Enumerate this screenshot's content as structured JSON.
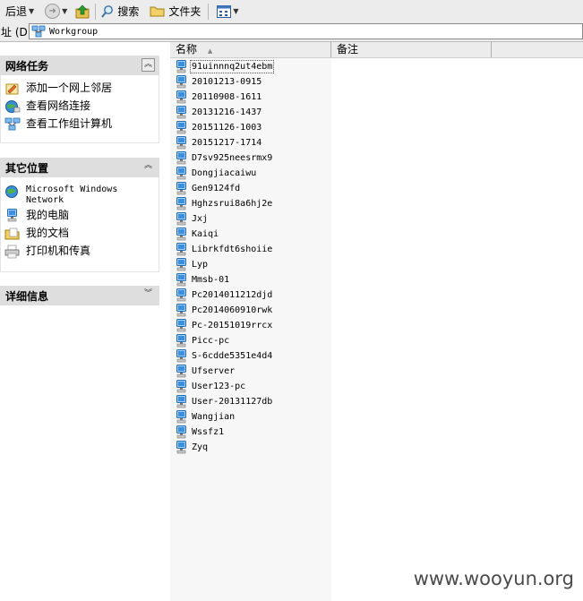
{
  "toolbar": {
    "back_label": "后退",
    "search_label": "搜索",
    "folders_label": "文件夹"
  },
  "address": {
    "label": "址 (D)",
    "value": "Workgroup"
  },
  "task_pane": {
    "network_tasks": {
      "title": "网络任务",
      "items": [
        {
          "label": "添加一个网上邻居",
          "icon": "add-network-place-icon"
        },
        {
          "label": "查看网络连接",
          "icon": "network-connections-icon"
        },
        {
          "label": "查看工作组计算机",
          "icon": "workgroup-computers-icon"
        }
      ]
    },
    "other_places": {
      "title": "其它位置",
      "items": [
        {
          "label": "Microsoft Windows Network",
          "icon": "windows-network-icon"
        },
        {
          "label": "我的电脑",
          "icon": "my-computer-icon"
        },
        {
          "label": "我的文档",
          "icon": "my-documents-icon"
        },
        {
          "label": "打印机和传真",
          "icon": "printers-icon"
        }
      ]
    },
    "details": {
      "title": "详细信息"
    }
  },
  "list": {
    "columns": [
      "名称",
      "备注"
    ],
    "sort_column": "名称",
    "items": [
      "91uinnnq2ut4ebm",
      "20101213-0915",
      "20110908-1611",
      "20131216-1437",
      "20151126-1003",
      "20151217-1714",
      "D7sv925neesrmx9",
      "Dongjiacaiwu",
      "Gen9124fd",
      "Hghzsrui8a6hj2e",
      "Jxj",
      "Kaiqi",
      "Librkfdt6shoiie",
      "Lyp",
      "Mmsb-01",
      "Pc2014011212djd",
      "Pc2014060910rwk",
      "Pc-20151019rrcx",
      "Picc-pc",
      "S-6cdde5351e4d4",
      "Ufserver",
      "User123-pc",
      "User-20131127db",
      "Wangjian",
      "Wssfz1",
      "Zyq"
    ],
    "selected": "91uinnnq2ut4ebm"
  },
  "watermark": "www.wooyun.org",
  "colors": {
    "panel_header": "#dedede",
    "toolbar_bg": "#ececec",
    "name_column_bg": "#f7f7f7"
  }
}
